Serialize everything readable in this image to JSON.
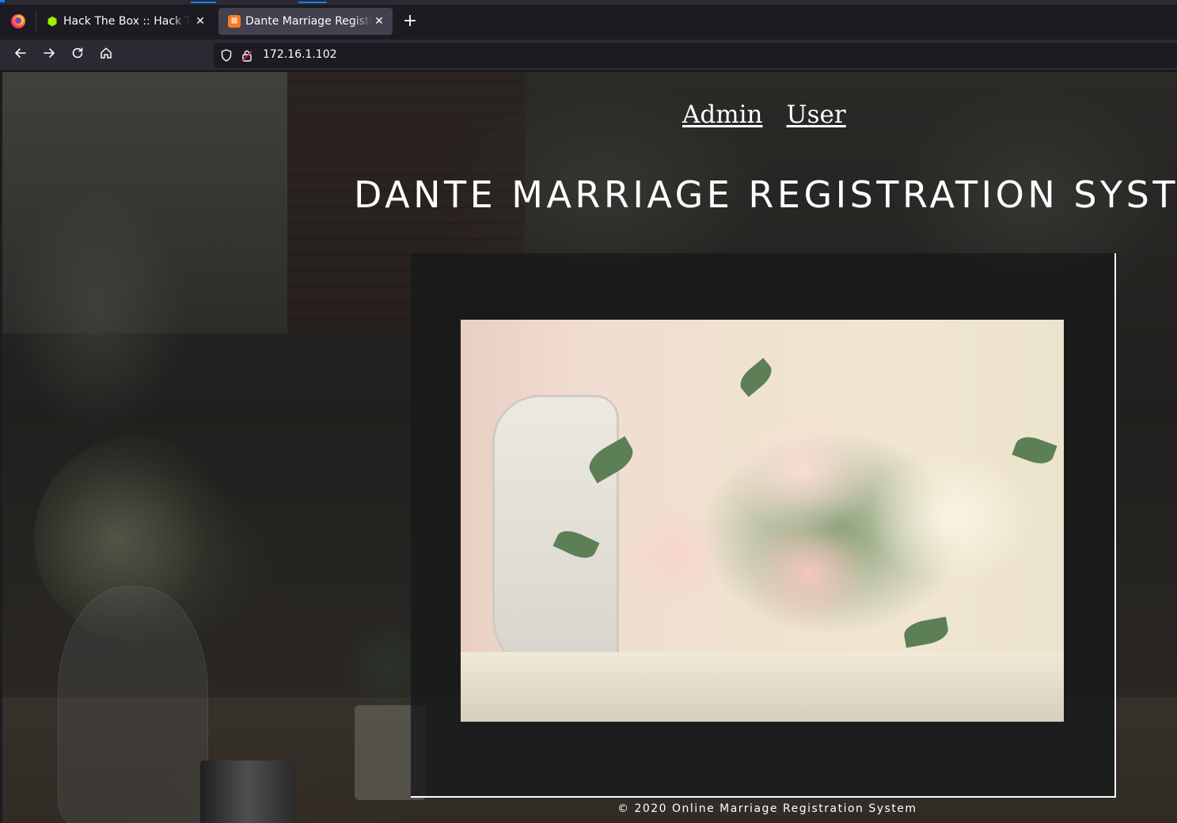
{
  "browser": {
    "tabs": [
      {
        "title": "Hack The Box :: Hack The Box",
        "icon": "hackthebox-cube-icon",
        "active": false
      },
      {
        "title": "Dante Marriage Registration System",
        "icon": "xampp-icon",
        "active": true
      }
    ],
    "new_tab_label": "+",
    "close_glyph": "✕",
    "url": "172.16.1.102"
  },
  "page": {
    "nav": {
      "admin_label": "Admin",
      "user_label": "User"
    },
    "title": "DANTE MARRIAGE REGISTRATION SYSTEM",
    "footer": "© 2020 Online Marriage Registration System"
  },
  "colors": {
    "chrome_dark": "#1c1b22",
    "chrome_toolbar": "#2b2a33",
    "active_tab": "#42414d",
    "accent": "#0a84ff",
    "panel_bg": "#171a1b",
    "text_white": "#ffffff"
  }
}
